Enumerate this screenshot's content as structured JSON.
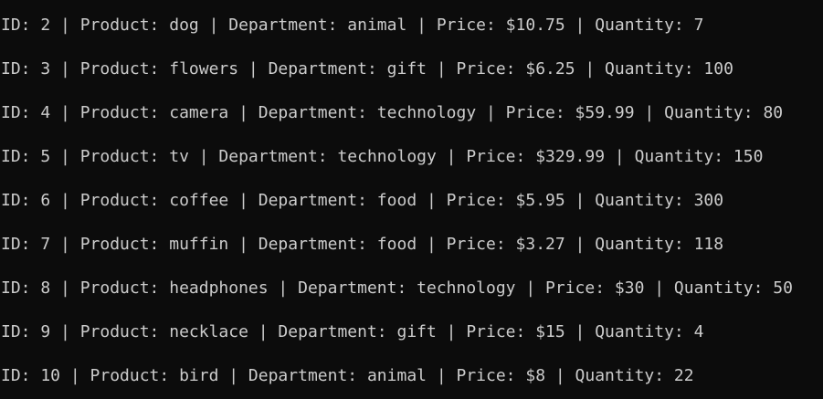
{
  "terminal": {
    "background": "#0c0c0c",
    "foreground": "#cccccc",
    "lines": [
      "ID: 2 | Product: dog | Department: animal | Price: $10.75 | Quantity: 7",
      "ID: 3 | Product: flowers | Department: gift | Price: $6.25 | Quantity: 100",
      "ID: 4 | Product: camera | Department: technology | Price: $59.99 | Quantity: 80",
      "ID: 5 | Product: tv | Department: technology | Price: $329.99 | Quantity: 150",
      "ID: 6 | Product: coffee | Department: food | Price: $5.95 | Quantity: 300",
      "ID: 7 | Product: muffin | Department: food | Price: $3.27 | Quantity: 118",
      "ID: 8 | Product: headphones | Department: technology | Price: $30 | Quantity: 50",
      "ID: 9 | Product: necklace | Department: gift | Price: $15 | Quantity: 4",
      "ID: 10 | Product: bird | Department: animal | Price: $8 | Quantity: 22"
    ]
  }
}
